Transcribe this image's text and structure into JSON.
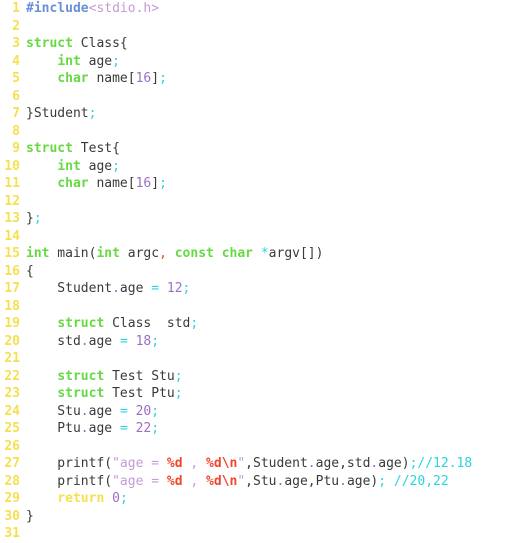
{
  "editor": {
    "language": "C",
    "background_color": "#ffffff",
    "gutter_color": "#f5e050",
    "total_lines": 31,
    "colors": {
      "keyword": "#66d943",
      "return_keyword": "#f5e050",
      "preprocessor": "#6a8fd8",
      "header": "#c49bd4",
      "string": "#c49bd4",
      "format_specifier": "#f0462d",
      "number": "#9b6fc4",
      "operator": "#2ad4e0",
      "member_dot": "#b05fd0",
      "comment": "#2ad4e0",
      "plain": "#3a3a3a"
    }
  },
  "lines": [
    {
      "num": "1",
      "text": "#include<stdio.h>"
    },
    {
      "num": "2",
      "text": ""
    },
    {
      "num": "3",
      "text": "struct Class{"
    },
    {
      "num": "4",
      "text": "    int age;"
    },
    {
      "num": "5",
      "text": "    char name[16];"
    },
    {
      "num": "6",
      "text": ""
    },
    {
      "num": "7",
      "text": "}Student;"
    },
    {
      "num": "8",
      "text": ""
    },
    {
      "num": "9",
      "text": "struct Test{"
    },
    {
      "num": "10",
      "text": "    int age;"
    },
    {
      "num": "11",
      "text": "    char name[16];"
    },
    {
      "num": "12",
      "text": ""
    },
    {
      "num": "13",
      "text": "};"
    },
    {
      "num": "14",
      "text": ""
    },
    {
      "num": "15",
      "text": "int main(int argc, const char *argv[])"
    },
    {
      "num": "16",
      "text": "{"
    },
    {
      "num": "17",
      "text": "    Student.age = 12;"
    },
    {
      "num": "18",
      "text": ""
    },
    {
      "num": "19",
      "text": "    struct Class  std;"
    },
    {
      "num": "20",
      "text": "    std.age = 18;"
    },
    {
      "num": "21",
      "text": ""
    },
    {
      "num": "22",
      "text": "    struct Test Stu;"
    },
    {
      "num": "23",
      "text": "    struct Test Ptu;"
    },
    {
      "num": "24",
      "text": "    Stu.age = 20;"
    },
    {
      "num": "25",
      "text": "    Ptu.age = 22;"
    },
    {
      "num": "26",
      "text": ""
    },
    {
      "num": "27",
      "text": "    printf(\"age = %d , %d\\n\",Student.age,std.age);//12.18"
    },
    {
      "num": "28",
      "text": "    printf(\"age = %d , %d\\n\",Stu.age,Ptu.age); //20,22"
    },
    {
      "num": "29",
      "text": "    return 0;"
    },
    {
      "num": "30",
      "text": "}"
    },
    {
      "num": "31",
      "text": ""
    }
  ],
  "tokens": {
    "l1": [
      [
        "#include",
        "t-pre"
      ],
      [
        "<stdio.h>",
        "t-hdr"
      ]
    ],
    "l3": [
      [
        "struct",
        "t-kw"
      ],
      [
        " Class{",
        "t-plain"
      ]
    ],
    "l4": [
      [
        "    ",
        "t-plain"
      ],
      [
        "int",
        "t-kw"
      ],
      [
        " age",
        "t-plain"
      ],
      [
        ";",
        "t-op"
      ]
    ],
    "l5": [
      [
        "    ",
        "t-plain"
      ],
      [
        "char",
        "t-kw"
      ],
      [
        " name[",
        "t-plain"
      ],
      [
        "16",
        "t-num"
      ],
      [
        "]",
        "t-plain"
      ],
      [
        ";",
        "t-op"
      ]
    ],
    "l7": [
      [
        "}Student",
        "t-plain"
      ],
      [
        ";",
        "t-op"
      ]
    ],
    "l9": [
      [
        "struct",
        "t-kw"
      ],
      [
        " Test{",
        "t-plain"
      ]
    ],
    "l10": [
      [
        "    ",
        "t-plain"
      ],
      [
        "int",
        "t-kw"
      ],
      [
        " age",
        "t-plain"
      ],
      [
        ";",
        "t-op"
      ]
    ],
    "l11": [
      [
        "    ",
        "t-plain"
      ],
      [
        "char",
        "t-kw"
      ],
      [
        " name[",
        "t-plain"
      ],
      [
        "16",
        "t-num"
      ],
      [
        "]",
        "t-plain"
      ],
      [
        ";",
        "t-op"
      ]
    ],
    "l13": [
      [
        "}",
        "t-plain"
      ],
      [
        ";",
        "t-op"
      ]
    ],
    "l15": [
      [
        "int",
        "t-kw"
      ],
      [
        " main(",
        "t-plain"
      ],
      [
        "int",
        "t-kw"
      ],
      [
        " argc",
        "t-plain"
      ],
      [
        ",",
        "t-comma"
      ],
      [
        " ",
        "t-plain"
      ],
      [
        "const",
        "t-kw"
      ],
      [
        " ",
        "t-plain"
      ],
      [
        "char",
        "t-kw"
      ],
      [
        " ",
        "t-plain"
      ],
      [
        "*",
        "t-op"
      ],
      [
        "argv[])",
        "t-plain"
      ]
    ],
    "l16": [
      [
        "{",
        "t-plain"
      ]
    ],
    "l17": [
      [
        "    Student",
        "t-plain"
      ],
      [
        ".",
        "t-dot"
      ],
      [
        "age ",
        "t-plain"
      ],
      [
        "=",
        "t-op"
      ],
      [
        " ",
        "t-plain"
      ],
      [
        "12",
        "t-num"
      ],
      [
        ";",
        "t-op"
      ]
    ],
    "l19": [
      [
        "    ",
        "t-plain"
      ],
      [
        "struct",
        "t-kw"
      ],
      [
        " Class  std",
        "t-plain"
      ],
      [
        ";",
        "t-op"
      ]
    ],
    "l20": [
      [
        "    std",
        "t-plain"
      ],
      [
        ".",
        "t-dot"
      ],
      [
        "age ",
        "t-plain"
      ],
      [
        "=",
        "t-op"
      ],
      [
        " ",
        "t-plain"
      ],
      [
        "18",
        "t-num"
      ],
      [
        ";",
        "t-op"
      ]
    ],
    "l22": [
      [
        "    ",
        "t-plain"
      ],
      [
        "struct",
        "t-kw"
      ],
      [
        " Test Stu",
        "t-plain"
      ],
      [
        ";",
        "t-op"
      ]
    ],
    "l23": [
      [
        "    ",
        "t-plain"
      ],
      [
        "struct",
        "t-kw"
      ],
      [
        " Test Ptu",
        "t-plain"
      ],
      [
        ";",
        "t-op"
      ]
    ],
    "l24": [
      [
        "    Stu",
        "t-plain"
      ],
      [
        ".",
        "t-dot"
      ],
      [
        "age ",
        "t-plain"
      ],
      [
        "=",
        "t-op"
      ],
      [
        " ",
        "t-plain"
      ],
      [
        "20",
        "t-num"
      ],
      [
        ";",
        "t-op"
      ]
    ],
    "l25": [
      [
        "    Ptu",
        "t-plain"
      ],
      [
        ".",
        "t-dot"
      ],
      [
        "age ",
        "t-plain"
      ],
      [
        "=",
        "t-op"
      ],
      [
        " ",
        "t-plain"
      ],
      [
        "22",
        "t-num"
      ],
      [
        ";",
        "t-op"
      ]
    ],
    "l27": [
      [
        "    printf(",
        "t-plain"
      ],
      [
        "\"age = ",
        "t-str"
      ],
      [
        "%d",
        "t-fmt"
      ],
      [
        " , ",
        "t-str"
      ],
      [
        "%d",
        "t-fmt"
      ],
      [
        "\\n",
        "t-fmt"
      ],
      [
        "\"",
        "t-str"
      ],
      [
        ",Student",
        "t-plain"
      ],
      [
        ".",
        "t-dot"
      ],
      [
        "age",
        "t-plain"
      ],
      [
        ",std",
        "t-plain"
      ],
      [
        ".",
        "t-dot"
      ],
      [
        "age)",
        "t-plain"
      ],
      [
        ";",
        "t-op"
      ],
      [
        "//12.18",
        "t-cmt"
      ]
    ],
    "l28": [
      [
        "    printf(",
        "t-plain"
      ],
      [
        "\"age = ",
        "t-str"
      ],
      [
        "%d",
        "t-fmt"
      ],
      [
        " , ",
        "t-str"
      ],
      [
        "%d",
        "t-fmt"
      ],
      [
        "\\n",
        "t-fmt"
      ],
      [
        "\"",
        "t-str"
      ],
      [
        ",Stu",
        "t-plain"
      ],
      [
        ".",
        "t-dot"
      ],
      [
        "age",
        "t-plain"
      ],
      [
        ",Ptu",
        "t-plain"
      ],
      [
        ".",
        "t-dot"
      ],
      [
        "age)",
        "t-plain"
      ],
      [
        ";",
        "t-op"
      ],
      [
        " ",
        "t-plain"
      ],
      [
        "//20,22",
        "t-cmt"
      ]
    ],
    "l29": [
      [
        "    ",
        "t-plain"
      ],
      [
        "return",
        "t-kw2"
      ],
      [
        " ",
        "t-plain"
      ],
      [
        "0",
        "t-num"
      ],
      [
        ";",
        "t-op"
      ]
    ],
    "l30": [
      [
        "}",
        "t-plain"
      ]
    ]
  }
}
